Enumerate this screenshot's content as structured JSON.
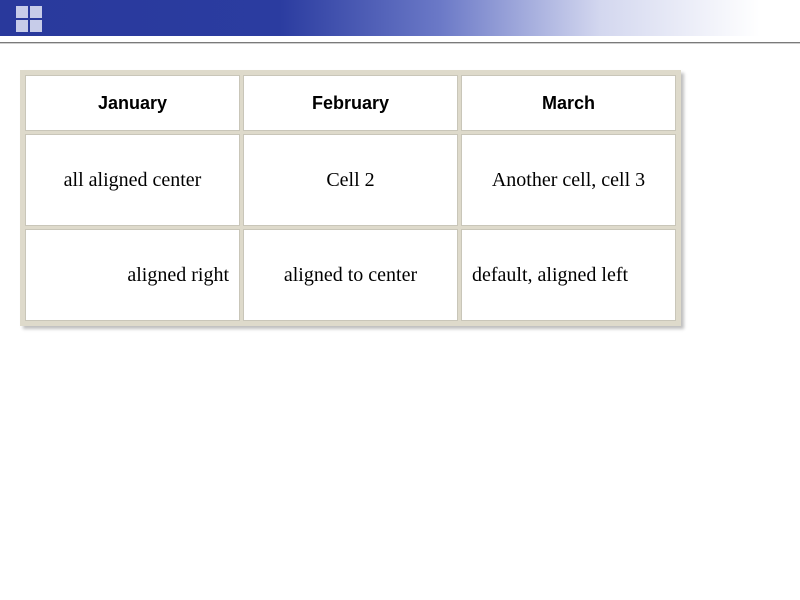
{
  "table": {
    "headers": [
      "January",
      "February",
      "March"
    ],
    "rows": [
      {
        "cells": [
          {
            "text": "all aligned center",
            "align": "center"
          },
          {
            "text": "Cell 2",
            "align": "center"
          },
          {
            "text": "Another cell, cell 3",
            "align": "wrap-center"
          }
        ]
      },
      {
        "cells": [
          {
            "text": "aligned right",
            "align": "right"
          },
          {
            "text": "aligned to center",
            "align": "center"
          },
          {
            "text": "default, aligned left",
            "align": "left"
          }
        ]
      }
    ]
  }
}
